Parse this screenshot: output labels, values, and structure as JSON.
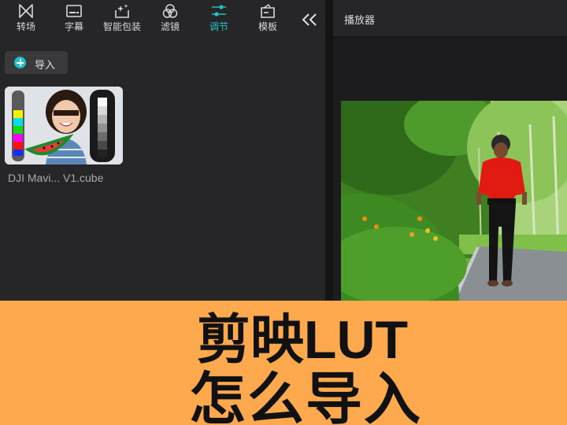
{
  "toolbar": {
    "items": [
      {
        "label": "转场",
        "icon": "transition-icon",
        "active": false
      },
      {
        "label": "字幕",
        "icon": "subtitle-icon",
        "active": false
      },
      {
        "label": "智能包装",
        "icon": "smart-package-icon",
        "active": false
      },
      {
        "label": "滤镜",
        "icon": "filter-icon",
        "active": false
      },
      {
        "label": "调节",
        "icon": "adjust-icon",
        "active": true
      },
      {
        "label": "模板",
        "icon": "template-icon",
        "active": false
      }
    ],
    "collapse_icon": "double-chevron-left-icon"
  },
  "media": {
    "import_label": "导入",
    "item_name": "DJI Mavi... V1.cube"
  },
  "player": {
    "title": "播放器"
  },
  "banner": {
    "line1": "剪映LUT",
    "line2": "怎么导入"
  },
  "colors": {
    "accent": "#22c1c8",
    "banner_bg": "#fea94d",
    "panel_bg": "#262628"
  }
}
